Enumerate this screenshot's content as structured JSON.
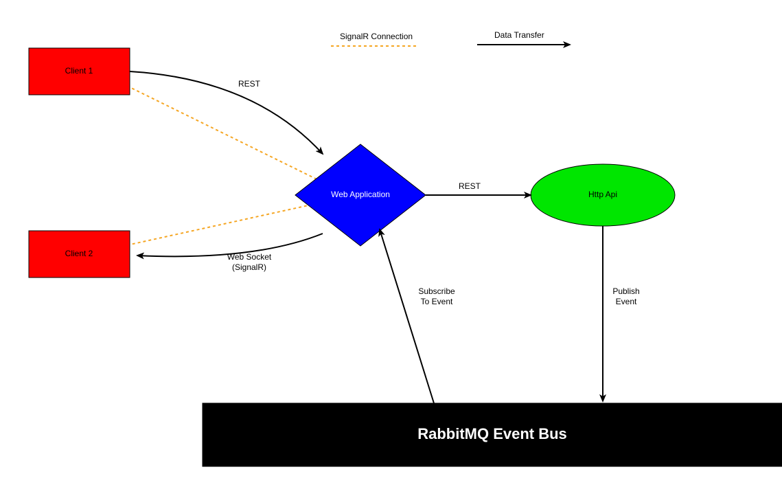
{
  "legend": {
    "signalr_label": "SignalR Connection",
    "data_transfer_label": "Data Transfer"
  },
  "nodes": {
    "client1": {
      "label": "Client 1",
      "fill": "#ff0000",
      "textColor": "#000000"
    },
    "client2": {
      "label": "Client 2",
      "fill": "#ff0000",
      "textColor": "#000000"
    },
    "webapp": {
      "label": "Web Application",
      "fill": "#0000ff",
      "textColor": "#ffffff"
    },
    "httpapi": {
      "label": "Http Api",
      "fill": "#00e600",
      "textColor": "#000000"
    },
    "eventbus": {
      "label": "RabbitMQ Event Bus",
      "fill": "#000000",
      "textColor": "#ffffff"
    }
  },
  "edges": {
    "client1_webapp_rest": {
      "label": "REST"
    },
    "webapp_client2_ws_line1": "Web Socket",
    "webapp_client2_ws_line2": "(SignalR)",
    "webapp_httpapi_rest": {
      "label": "REST"
    },
    "httpapi_eventbus_publish_line1": "Publish",
    "httpapi_eventbus_publish_line2": "Event",
    "eventbus_webapp_subscribe_line1": "Subscribe",
    "eventbus_webapp_subscribe_line2": "To Event"
  },
  "colors": {
    "signalr_line": "#f5a623",
    "arrow_line": "#000000"
  }
}
